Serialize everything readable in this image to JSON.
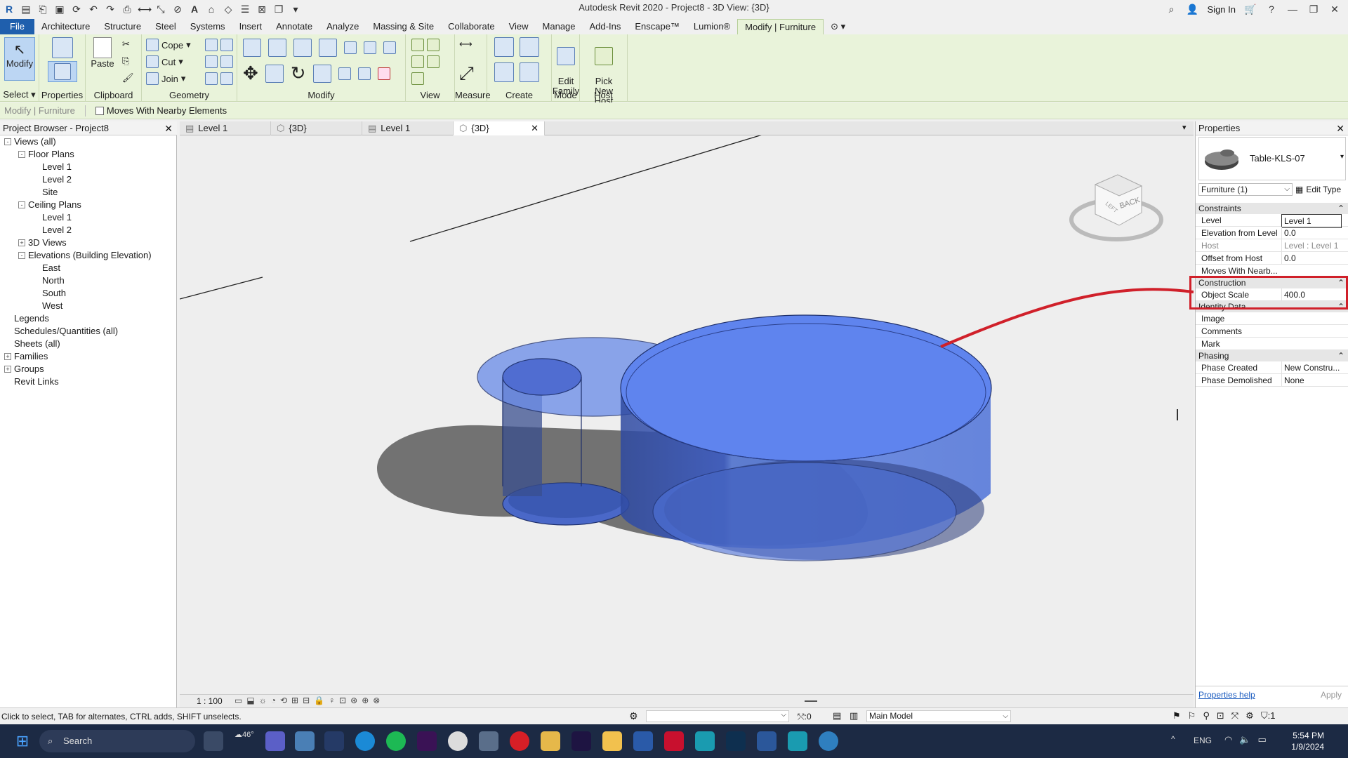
{
  "app": {
    "title": "Autodesk Revit 2020 - Project8 - 3D View: {3D}",
    "sign_in": "Sign In"
  },
  "ribbon_tabs": [
    "File",
    "Architecture",
    "Structure",
    "Steel",
    "Systems",
    "Insert",
    "Annotate",
    "Analyze",
    "Massing & Site",
    "Collaborate",
    "View",
    "Manage",
    "Add-Ins",
    "Enscape™",
    "Lumion®",
    "Modify | Furniture"
  ],
  "ribbon": {
    "modify": "Modify",
    "select": "Select",
    "properties": "Properties",
    "paste": "Paste",
    "clipboard": "Clipboard",
    "cope": "Cope",
    "cut": "Cut",
    "join": "Join",
    "geometry": "Geometry",
    "modify_panel": "Modify",
    "view_panel": "View",
    "measure": "Measure",
    "create": "Create",
    "edit_family": "Edit\nFamily",
    "mode": "Mode",
    "pick_new_host": "Pick\nNew Host",
    "host": "Host"
  },
  "options_bar": {
    "context": "Modify | Furniture",
    "moves_with": "Moves With Nearby Elements"
  },
  "project_browser": {
    "title": "Project Browser - Project8",
    "items": [
      {
        "label": "Views (all)",
        "level": 0,
        "toggle": "-"
      },
      {
        "label": "Floor Plans",
        "level": 1,
        "toggle": "-"
      },
      {
        "label": "Level 1",
        "level": 2,
        "toggle": ""
      },
      {
        "label": "Level 2",
        "level": 2,
        "toggle": ""
      },
      {
        "label": "Site",
        "level": 2,
        "toggle": ""
      },
      {
        "label": "Ceiling Plans",
        "level": 1,
        "toggle": "-"
      },
      {
        "label": "Level 1",
        "level": 2,
        "toggle": ""
      },
      {
        "label": "Level 2",
        "level": 2,
        "toggle": ""
      },
      {
        "label": "3D Views",
        "level": 1,
        "toggle": "+"
      },
      {
        "label": "Elevations (Building Elevation)",
        "level": 1,
        "toggle": "-"
      },
      {
        "label": "East",
        "level": 2,
        "toggle": ""
      },
      {
        "label": "North",
        "level": 2,
        "toggle": ""
      },
      {
        "label": "South",
        "level": 2,
        "toggle": ""
      },
      {
        "label": "West",
        "level": 2,
        "toggle": ""
      },
      {
        "label": "Legends",
        "level": 0,
        "toggle": ""
      },
      {
        "label": "Schedules/Quantities (all)",
        "level": 0,
        "toggle": ""
      },
      {
        "label": "Sheets (all)",
        "level": 0,
        "toggle": ""
      },
      {
        "label": "Families",
        "level": 0,
        "toggle": "+"
      },
      {
        "label": "Groups",
        "level": 0,
        "toggle": "+"
      },
      {
        "label": "Revit Links",
        "level": 0,
        "toggle": ""
      }
    ]
  },
  "view_tabs": [
    {
      "label": "Level 1",
      "active": false
    },
    {
      "label": "{3D}",
      "active": false
    },
    {
      "label": "Level 1",
      "active": false
    },
    {
      "label": "{3D}",
      "active": true
    }
  ],
  "view_cube": {
    "face": "BACK",
    "top": "LEFT"
  },
  "view_bar": {
    "scale": "1 : 100"
  },
  "properties": {
    "title": "Properties",
    "type_name": "Table-KLS-07",
    "selector": "Furniture (1)",
    "edit_type": "Edit Type",
    "sections": [
      {
        "name": "Constraints",
        "rows": [
          {
            "key": "Level",
            "value": "Level 1",
            "grey": false
          },
          {
            "key": "Elevation from Level",
            "value": "0.0",
            "grey": false
          },
          {
            "key": "Host",
            "value": "Level : Level 1",
            "grey": true
          },
          {
            "key": "Offset from Host",
            "value": "0.0",
            "grey": false
          },
          {
            "key": "Moves With Nearb...",
            "value": "",
            "grey": false
          }
        ]
      },
      {
        "name": "Construction",
        "rows": [
          {
            "key": "Object Scale",
            "value": "400.0",
            "grey": false
          }
        ]
      },
      {
        "name": "Identity Data",
        "rows": [
          {
            "key": "Image",
            "value": "",
            "grey": false
          },
          {
            "key": "Comments",
            "value": "",
            "grey": false
          },
          {
            "key": "Mark",
            "value": "",
            "grey": false
          }
        ]
      },
      {
        "name": "Phasing",
        "rows": [
          {
            "key": "Phase Created",
            "value": "New Constru...",
            "grey": false
          },
          {
            "key": "Phase Demolished",
            "value": "None",
            "grey": false
          }
        ]
      }
    ],
    "help": "Properties help",
    "apply": "Apply"
  },
  "status_bar": {
    "hint": "Click to select, TAB for alternates, CTRL adds, SHIFT unselects.",
    "zero": ":0",
    "model": "Main Model",
    "filter": ":1"
  },
  "taskbar": {
    "search": "Search",
    "weather": "46°",
    "lang": "ENG",
    "time": "5:54 PM",
    "date": "1/9/2024"
  },
  "colors": {
    "accent": "#1f5fad",
    "ribbon": "#e9f3da",
    "object": "#5b7fe0",
    "highlight": "#d0202a"
  }
}
